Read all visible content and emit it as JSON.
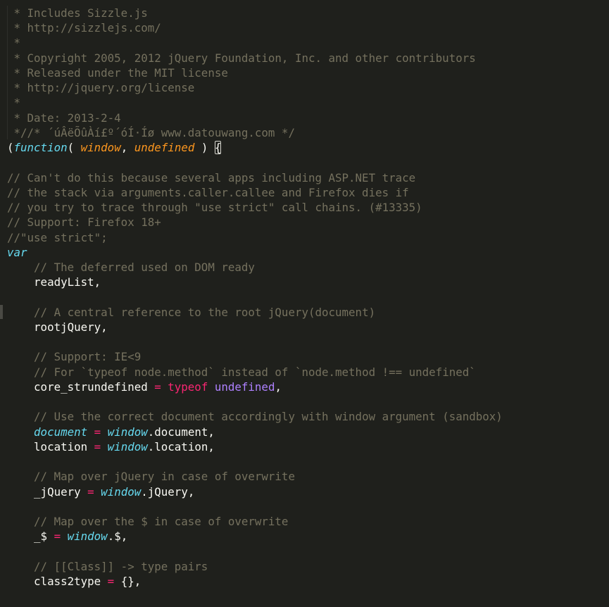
{
  "colors": {
    "background": "#1f201c",
    "comment": "#75715e",
    "keyword": "#66d9ef",
    "parameter": "#fd971f",
    "operator": "#f92672",
    "constant": "#ae81ff",
    "text": "#f8f8f2"
  },
  "lines": [
    [
      [
        "cm",
        " * Includes Sizzle.js"
      ]
    ],
    [
      [
        "cm",
        " * http://sizzlejs.com/"
      ]
    ],
    [
      [
        "cm",
        " *"
      ]
    ],
    [
      [
        "cm",
        " * Copyright 2005, 2012 jQuery Foundation, Inc. and other contributors"
      ]
    ],
    [
      [
        "cm",
        " * Released under the MIT license"
      ]
    ],
    [
      [
        "cm",
        " * http://jquery.org/license"
      ]
    ],
    [
      [
        "cm",
        " *"
      ]
    ],
    [
      [
        "cm",
        " * Date: 2013-2-4"
      ]
    ],
    [
      [
        "cm",
        " *//* ´úÂëÕûÀí£º´óÍ·Íø www.datouwang.com */"
      ]
    ],
    [
      [
        "",
        "("
      ],
      [
        "kw",
        "function"
      ],
      [
        "",
        "( "
      ],
      [
        "param",
        "window"
      ],
      [
        "",
        ", "
      ],
      [
        "param",
        "undefined"
      ],
      [
        "",
        " ) "
      ],
      [
        "br",
        "{"
      ]
    ],
    [],
    [
      [
        "cm",
        "// Can't do this because several apps including ASP.NET trace"
      ]
    ],
    [
      [
        "cm",
        "// the stack via arguments.caller.callee and Firefox dies if"
      ]
    ],
    [
      [
        "cm",
        "// you try to trace through \"use strict\" call chains. (#13335)"
      ]
    ],
    [
      [
        "cm",
        "// Support: Firefox 18+"
      ]
    ],
    [
      [
        "cm",
        "//\"use strict\";"
      ]
    ],
    [
      [
        "kw",
        "var"
      ]
    ],
    [
      [
        "",
        "    "
      ],
      [
        "cm",
        "// The deferred used on DOM ready"
      ]
    ],
    [
      [
        "",
        "    readyList,"
      ]
    ],
    [],
    [
      [
        "",
        "    "
      ],
      [
        "cm",
        "// A central reference to the root jQuery(document)"
      ]
    ],
    [
      [
        "",
        "    rootjQuery,"
      ]
    ],
    [],
    [
      [
        "",
        "    "
      ],
      [
        "cm",
        "// Support: IE<9"
      ]
    ],
    [
      [
        "",
        "    "
      ],
      [
        "cm",
        "// For `typeof node.method` instead of `node.method !== undefined`"
      ]
    ],
    [
      [
        "",
        "    core_strundefined "
      ],
      [
        "op",
        "="
      ],
      [
        "",
        " "
      ],
      [
        "tk",
        "typeof"
      ],
      [
        "",
        " "
      ],
      [
        "const",
        "undefined"
      ],
      [
        "",
        ","
      ]
    ],
    [],
    [
      [
        "",
        "    "
      ],
      [
        "cm",
        "// Use the correct document accordingly with window argument (sandbox)"
      ]
    ],
    [
      [
        "",
        "    "
      ],
      [
        "kw",
        "document"
      ],
      [
        "",
        " "
      ],
      [
        "op",
        "="
      ],
      [
        "",
        " "
      ],
      [
        "kw",
        "window"
      ],
      [
        "",
        ".document,"
      ]
    ],
    [
      [
        "",
        "    location "
      ],
      [
        "op",
        "="
      ],
      [
        "",
        " "
      ],
      [
        "kw",
        "window"
      ],
      [
        "",
        ".location,"
      ]
    ],
    [],
    [
      [
        "",
        "    "
      ],
      [
        "cm",
        "// Map over jQuery in case of overwrite"
      ]
    ],
    [
      [
        "",
        "    _jQuery "
      ],
      [
        "op",
        "="
      ],
      [
        "",
        " "
      ],
      [
        "kw",
        "window"
      ],
      [
        "",
        ".jQuery,"
      ]
    ],
    [],
    [
      [
        "",
        "    "
      ],
      [
        "cm",
        "// Map over the $ in case of overwrite"
      ]
    ],
    [
      [
        "",
        "    _$ "
      ],
      [
        "op",
        "="
      ],
      [
        "",
        " "
      ],
      [
        "kw",
        "window"
      ],
      [
        "",
        ".$,"
      ]
    ],
    [],
    [
      [
        "",
        "    "
      ],
      [
        "cm",
        "// [[Class]] -> type pairs"
      ]
    ],
    [
      [
        "",
        "    class2type "
      ],
      [
        "op",
        "="
      ],
      [
        "",
        " {},"
      ]
    ]
  ]
}
